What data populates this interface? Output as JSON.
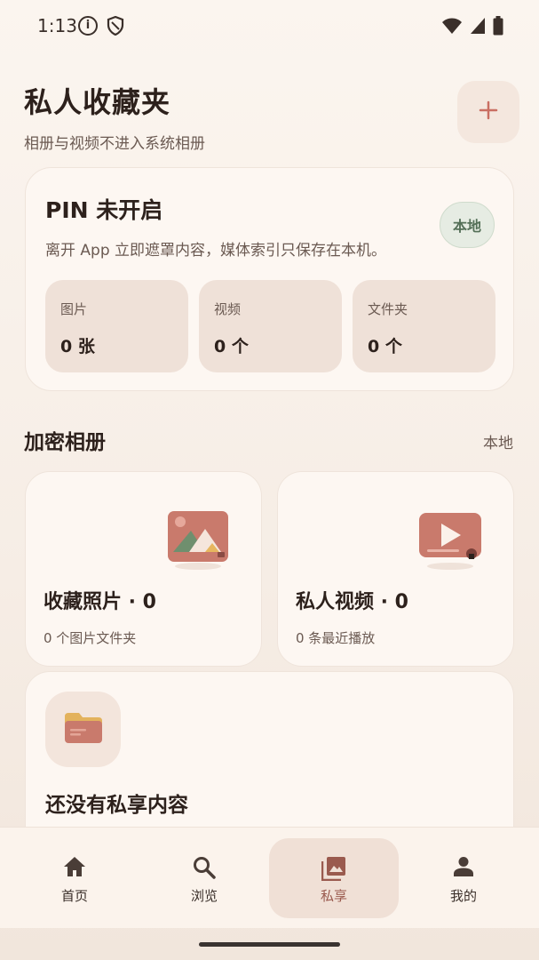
{
  "status_bar": {
    "time": "1:13"
  },
  "header": {
    "title": "私人收藏夹",
    "subtitle": "相册与视频不进入系统相册",
    "add_icon": "plus-icon"
  },
  "pin_card": {
    "title": "PIN 未开启",
    "description": "离开 App 立即遮罩内容，媒体索引只保存在本机。",
    "badge": "本地",
    "stats": [
      {
        "label": "图片",
        "value": "0 张"
      },
      {
        "label": "视频",
        "value": "0 个"
      },
      {
        "label": "文件夹",
        "value": "0 个"
      }
    ]
  },
  "section": {
    "title": "加密相册",
    "right_label": "本地"
  },
  "albums": [
    {
      "title": "收藏照片 · 0",
      "subtitle": "0 个图片文件夹",
      "icon": "photo-album-icon"
    },
    {
      "title": "私人视频 · 0",
      "subtitle": "0 条最近播放",
      "icon": "video-album-icon"
    }
  ],
  "empty_state": {
    "title": "还没有私享内容",
    "icon": "folder-icon"
  },
  "bottom_nav": {
    "items": [
      {
        "label": "首页",
        "icon": "home-icon"
      },
      {
        "label": "浏览",
        "icon": "search-icon"
      },
      {
        "label": "私享",
        "icon": "gallery-icon",
        "active": true
      },
      {
        "label": "我的",
        "icon": "person-icon"
      }
    ]
  },
  "colors": {
    "accent": "#c96f62",
    "badge_green": "#557058",
    "background": "#f8f0e8"
  }
}
